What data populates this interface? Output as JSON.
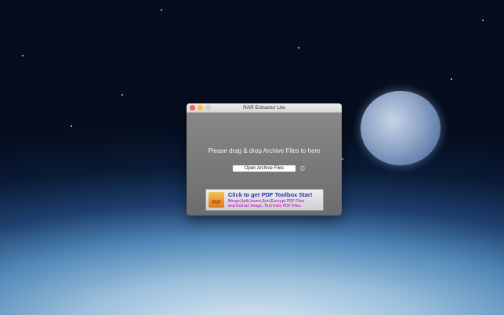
{
  "window": {
    "title": "RAR Extractor Lite"
  },
  "main": {
    "drop_hint": "Please drag & drop Archive Files to here",
    "open_button": "Open Archive Files"
  },
  "banner": {
    "icon_text": "PDF",
    "headline": "Click to get PDF Toolbox Star!",
    "line1": "Merge,Split,Insert,Sort,Encrypt PDF Files",
    "line2": "and Extract Image, Text from PDF Files."
  },
  "colors": {
    "close": "#fc605b",
    "minimize": "#fdbc40",
    "zoom": "#cfcfcf"
  }
}
